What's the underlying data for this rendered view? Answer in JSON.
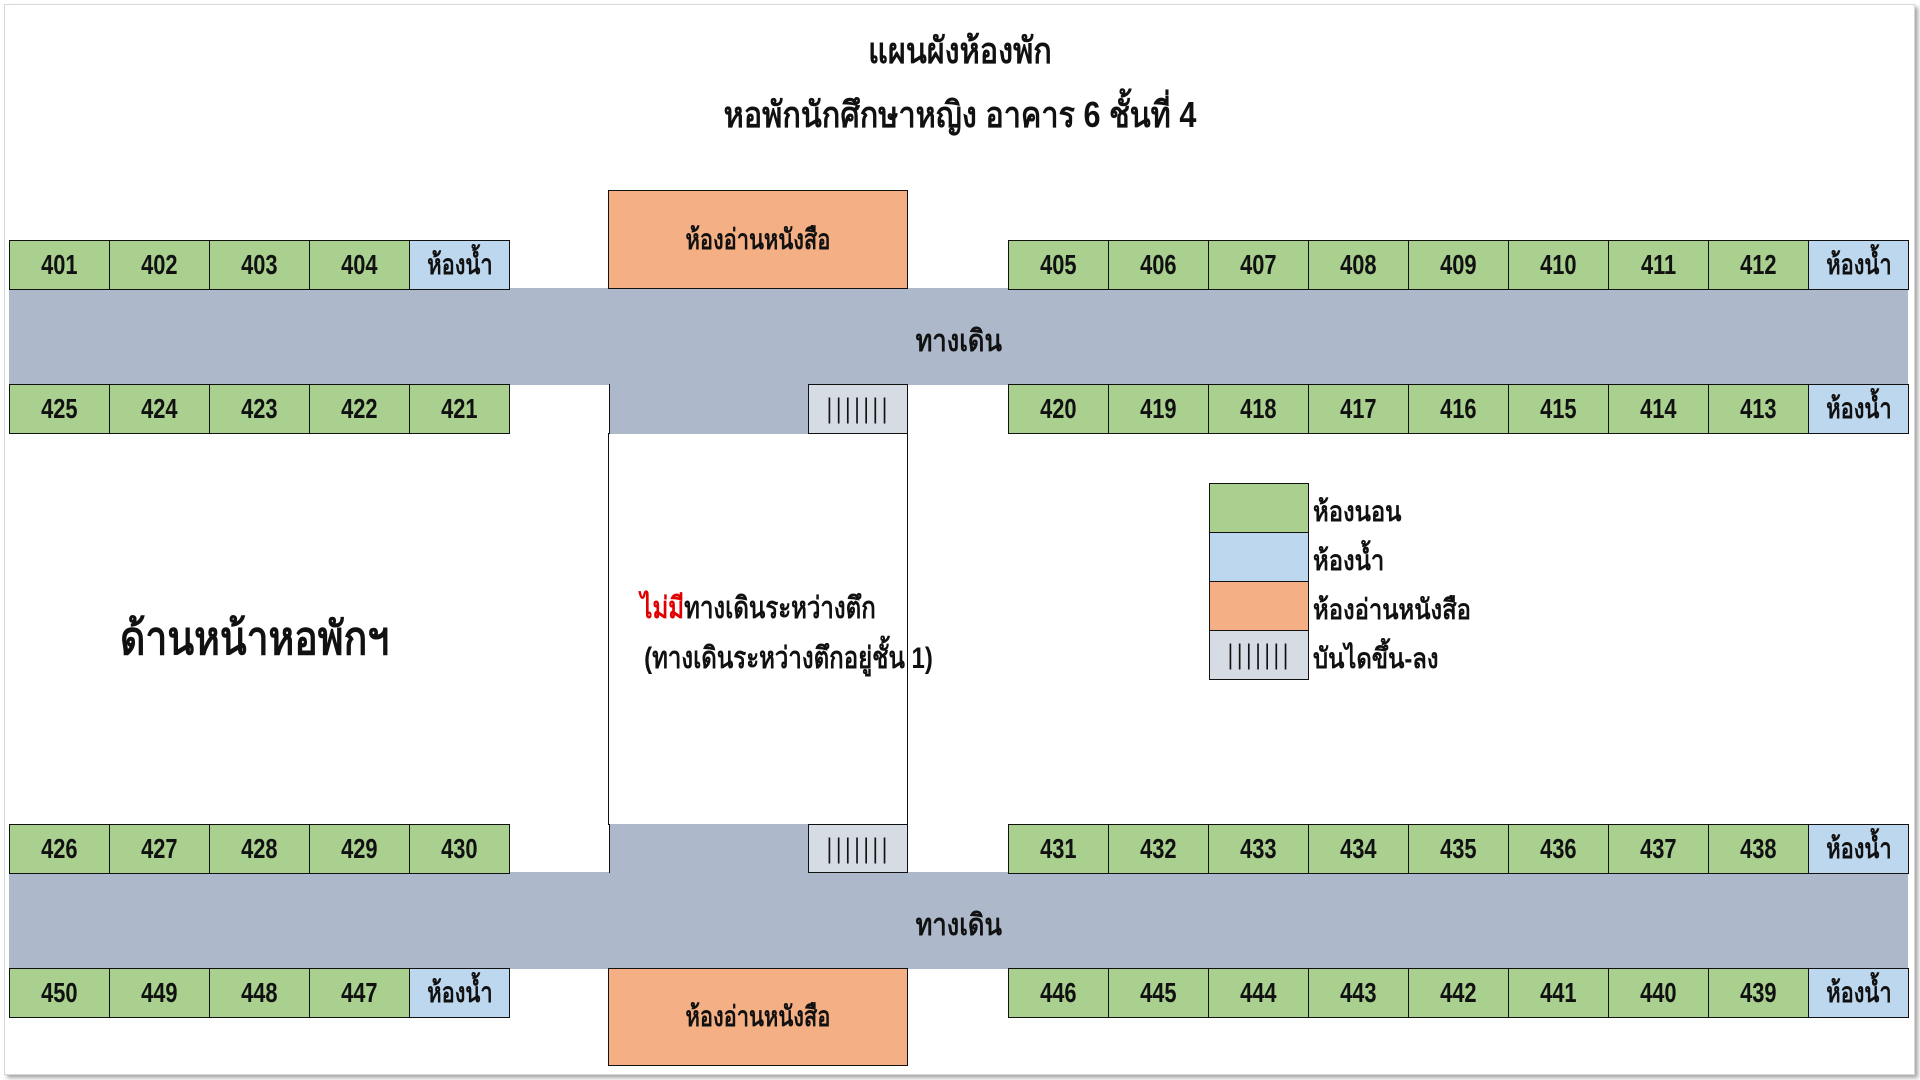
{
  "title": {
    "line1": "แผนผังห้องพัก",
    "line2": "หอพักนักศึกษาหญิง อาคาร 6 ชั้นที่ 4"
  },
  "rows": {
    "r1_left": [
      "401",
      "402",
      "403",
      "404"
    ],
    "r1_right": [
      "405",
      "406",
      "407",
      "408",
      "409",
      "410",
      "411",
      "412"
    ],
    "r2_left": [
      "425",
      "424",
      "423",
      "422",
      "421"
    ],
    "r2_right": [
      "420",
      "419",
      "418",
      "417",
      "416",
      "415",
      "414",
      "413"
    ],
    "r3_left": [
      "426",
      "427",
      "428",
      "429",
      "430"
    ],
    "r3_right": [
      "431",
      "432",
      "433",
      "434",
      "435",
      "436",
      "437",
      "438"
    ],
    "r4_left": [
      "450",
      "449",
      "448",
      "447"
    ],
    "r4_right": [
      "446",
      "445",
      "444",
      "443",
      "442",
      "441",
      "440",
      "439"
    ]
  },
  "labels": {
    "restroom": "ห้องน้ำ",
    "reading_room": "ห้องอ่านหนังสือ",
    "corridor": "ทางเดิน",
    "stairs": "|||||||",
    "no_walkway_red": "ไม่มี",
    "no_walkway_rest": "ทางเดินระหว่างตึก",
    "walkway_note": "(ทางเดินระหว่างตึกอยู่ชั้น 1)",
    "front": "ด้านหน้าหอพักฯ"
  },
  "legend": [
    {
      "label": "ห้องนอน",
      "color": "#a9d08e"
    },
    {
      "label": "ห้องน้ำ",
      "color": "#bdd7ee"
    },
    {
      "label": "ห้องอ่านหนังสือ",
      "color": "#f4b084"
    },
    {
      "label": "บันไดขึ้น-ลง",
      "color": "#d6dce4",
      "symbol": "|||||||"
    }
  ],
  "colors": {
    "bedroom": "#a9d08e",
    "restroom": "#bdd7ee",
    "reading_room": "#f4b084",
    "corridor": "#adb9ca",
    "stairs": "#d6dce4",
    "highlight_red": "#e00000"
  }
}
